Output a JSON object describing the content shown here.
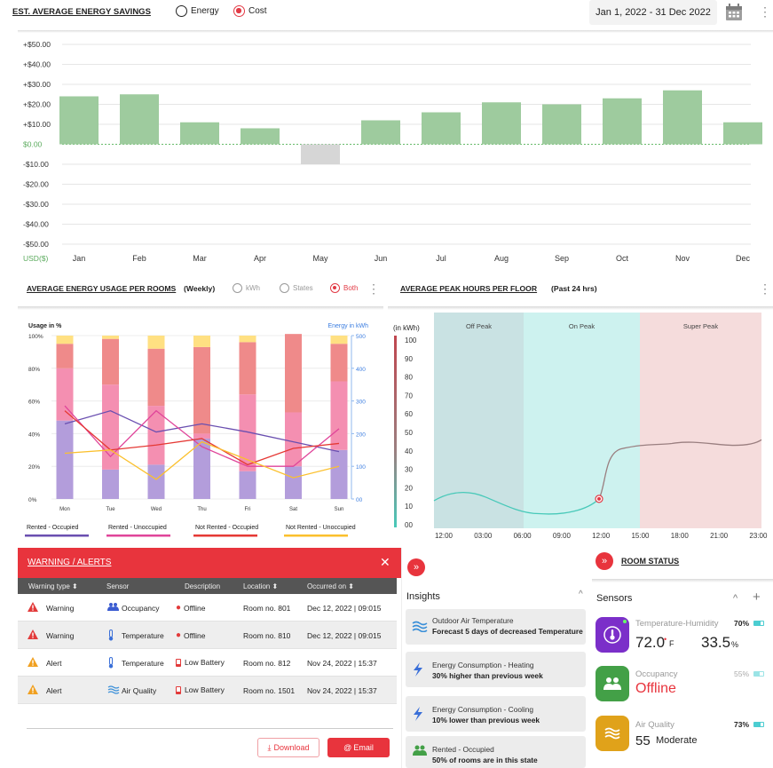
{
  "savings": {
    "title": "EST. AVERAGE ENERGY SAVINGS",
    "radio_energy": "Energy",
    "radio_cost": "Cost",
    "date_range": "Jan 1, 2022  -  31 Dec 2022"
  },
  "chart_data": [
    {
      "type": "bar",
      "title": "EST. AVERAGE ENERGY SAVINGS",
      "categories": [
        "Jan",
        "Feb",
        "Mar",
        "Apr",
        "May",
        "Jun",
        "Jul",
        "Aug",
        "Sep",
        "Oct",
        "Nov",
        "Dec"
      ],
      "values": [
        24,
        25,
        11,
        8,
        -10,
        null,
        12,
        16,
        21,
        20,
        23,
        27,
        11
      ],
      "ylabel": "USD($)",
      "yticks": [
        "+$50.00",
        "+$40.00",
        "+$30.00",
        "+$20.00",
        "+$10.00",
        "$0.00",
        "-$10.00",
        "-$20.00",
        "-$30.00",
        "-$40.00",
        "-$50.00"
      ],
      "ylim": [
        -50,
        50
      ],
      "colors": {
        "positive": "#9ecb9e",
        "negative": "#d6d6d6",
        "zero_line": "#66bb6a"
      }
    },
    {
      "type": "bar",
      "title": "AVERAGE ENERGY USAGE PER ROOMS",
      "categories": [
        "Mon",
        "Tue",
        "Wed",
        "Thu",
        "Fri",
        "Sat",
        "Sun"
      ],
      "ylabel": "Usage in %",
      "y2label": "Energy in kWh",
      "yticks": [
        "100%",
        "80%",
        "60%",
        "40%",
        "20%",
        "0%"
      ],
      "y2ticks": [
        "500",
        "400",
        "300",
        "200",
        "100",
        "00"
      ],
      "stacks": [
        {
          "name": "Rented - Occupied",
          "color": "#b39ddb",
          "values": [
            48,
            18,
            21,
            37,
            17,
            20,
            30
          ]
        },
        {
          "name": "Rented - Unoccupied",
          "color": "#f48fb1",
          "values": [
            32,
            52,
            36,
            3,
            47,
            33,
            42
          ]
        },
        {
          "name": "Not Rented - Occupied",
          "color": "#ef8a8a",
          "values": [
            15,
            28,
            35,
            53,
            32,
            48,
            23
          ]
        },
        {
          "name": "Not Rented - Unoccupied",
          "color": "#ffe082",
          "values": [
            5,
            2,
            8,
            7,
            4,
            0,
            5
          ]
        }
      ],
      "lines": [
        {
          "name": "Rented - Occupied",
          "color": "#6a4fb0",
          "values": [
            230,
            270,
            205,
            230,
            205,
            175,
            145
          ]
        },
        {
          "name": "Rented - Unoccupied",
          "color": "#e0459a",
          "values": [
            285,
            130,
            270,
            160,
            100,
            100,
            215
          ]
        },
        {
          "name": "Not Rented - Occupied",
          "color": "#e53935",
          "values": [
            270,
            150,
            165,
            185,
            105,
            155,
            170
          ]
        },
        {
          "name": "Not Rented - Unoccupied",
          "color": "#fbc02d",
          "values": [
            140,
            150,
            60,
            175,
            120,
            65,
            100
          ]
        }
      ]
    },
    {
      "type": "line",
      "title": "AVERAGE PEAK HOURS PER FLOOR",
      "ylabel": "(in kWh)",
      "x": [
        "12:00",
        "03:00",
        "06:00",
        "09:00",
        "12:00",
        "15:00",
        "18:00",
        "21:00",
        "23:00"
      ],
      "yticks": [
        "100",
        "90",
        "80",
        "70",
        "60",
        "50",
        "40",
        "30",
        "20",
        "10",
        "00"
      ],
      "ylim": [
        0,
        100
      ],
      "values": [
        13,
        17,
        9,
        6,
        10,
        18,
        43,
        43,
        44,
        46
      ],
      "zones": [
        {
          "label": "Off Peak",
          "color": "#c9e2e3"
        },
        {
          "label": "On Peak",
          "color": "#cdf2ef"
        },
        {
          "label": "Super Peak",
          "color": "#f5dcdc"
        }
      ]
    }
  ],
  "rooms": {
    "title": "AVERAGE ENERGY USAGE PER ROOMS",
    "subtitle": "(Weekly)",
    "radio_kwh": "kWh",
    "radio_states": "States",
    "radio_both": "Both"
  },
  "peak": {
    "title": "AVERAGE PEAK HOURS PER FLOOR",
    "subtitle": "(Past 24 hrs)"
  },
  "warnings": {
    "title": "WARNING / ALERTS",
    "close": "✕",
    "headers": [
      "Warning type ⬍",
      "Sensor",
      "Description",
      "Location ⬍",
      "Occurred on ⬍"
    ],
    "rows": [
      {
        "type": "Warning",
        "sensor": "Occupancy",
        "desc": "Offline",
        "location": "Room no. 801",
        "date": "Dec 12, 2022  |  09:015"
      },
      {
        "type": "Warning",
        "sensor": "Temperature",
        "desc": "Offline",
        "location": "Room no. 810",
        "date": "Dec 12, 2022  |  09:015"
      },
      {
        "type": "Alert",
        "sensor": "Temperature",
        "desc": "Low Battery",
        "location": "Room no. 812",
        "date": "Nov 24, 2022  |  15:37"
      },
      {
        "type": "Alert",
        "sensor": "Air Quality",
        "desc": "Low Battery",
        "location": "Room no. 1501",
        "date": "Nov 24, 2022  |  15:37"
      }
    ],
    "download": "Download",
    "email": "Email"
  },
  "insights": {
    "title": "Insights",
    "cards": [
      {
        "line1": "Outdoor Air Temperature",
        "line2": "Forecast 5 days of decreased Temperature",
        "icon": "air-icon"
      },
      {
        "line1": "Energy Consumption - Heating",
        "line2": "30% higher than previous week",
        "icon": "bolt-icon"
      },
      {
        "line1": "Energy Consumption - Cooling",
        "line2": "10% lower than previous week",
        "icon": "bolt-icon"
      },
      {
        "line1": "Rented - Occupied",
        "line2": "50% of rooms are in this state",
        "icon": "people-icon"
      }
    ]
  },
  "room_status": {
    "title": "ROOM STATUS",
    "sensors_label": "Sensors",
    "sensors": [
      {
        "name": "Temperature-Humidity",
        "battery": "70%",
        "value": "72.0",
        "unit": "F",
        "value2": "33.5",
        "unit2": "%",
        "color": "#7b2fc9"
      },
      {
        "name": "Occupancy",
        "battery": "55%",
        "status": "Offline",
        "color": "#43a047"
      },
      {
        "name": "Air Quality",
        "battery": "73%",
        "value": "55",
        "quality": "Moderate",
        "color": "#e0a21a"
      }
    ]
  }
}
